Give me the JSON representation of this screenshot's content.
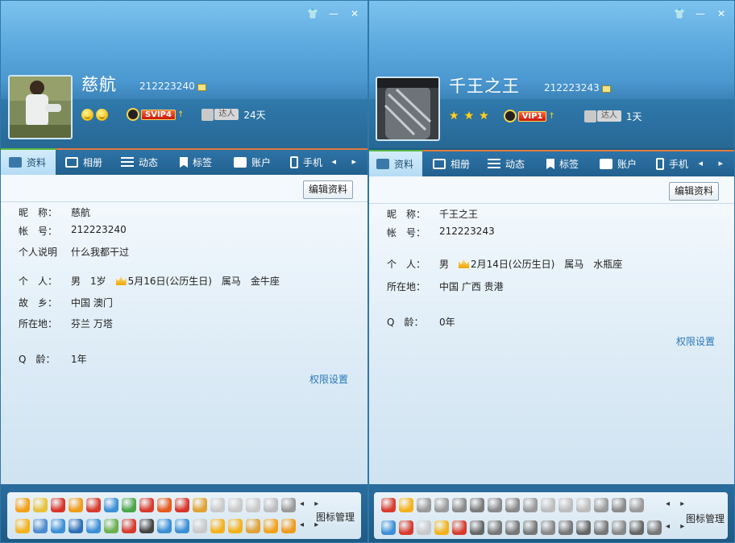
{
  "window_controls": {
    "skin": "👕",
    "minimize": "—",
    "close": "✕"
  },
  "left": {
    "nickname": "慈航",
    "qq_number": "212223240",
    "vip_label": "SVIP4",
    "vip_arrow": "↑",
    "daren_label": "达人",
    "days": "24天",
    "tabs": [
      "资料",
      "相册",
      "动态",
      "标签",
      "账户",
      "手机"
    ],
    "tab_arrows": "◂ ▸",
    "edit_button": "编辑资料",
    "fields": [
      {
        "label": "昵　称：",
        "value": "慈航"
      },
      {
        "label": "帐　号：",
        "value": "212223240"
      },
      {
        "label": "个人说明",
        "value": "什么我都干过"
      },
      {
        "label": "个　人：",
        "value": "男　1岁　",
        "birthday": "5月16日(公历生日)",
        "extra": "　属马　金牛座"
      },
      {
        "label": "故　乡：",
        "value": "中国 澳门"
      },
      {
        "label": "所在地：",
        "value": "芬兰 万塔"
      },
      {
        "label": "Q　龄：",
        "value": "1年"
      }
    ],
    "perm_link": "权限设置",
    "icon_manager": "图标管理",
    "tray_arrows": "◂ ▸",
    "icon_colors_row1": [
      "#f4a11a",
      "#e8c23a",
      "#d9342a",
      "#f19b1a",
      "#d83a2c",
      "#3c8fd6",
      "#4aa64a",
      "#d83a2c",
      "#e45b1e",
      "#d9342a",
      "#e0a233",
      "#c9c9c9",
      "#c9c9c9",
      "#c9c9c9",
      "#bdbdbd",
      "#9a9a9a"
    ],
    "icon_colors_row2": [
      "#f4b21a",
      "#4b8ad0",
      "#3c8fd6",
      "#2f6fb8",
      "#3c8fd6",
      "#6ab04c",
      "#d83a2c",
      "#444444",
      "#3c8fd6",
      "#3c8fd6",
      "#c9c9c9",
      "#f4b21a",
      "#f4b21a",
      "#e0a233",
      "#f4a11a",
      "#f19b1a"
    ]
  },
  "right": {
    "nickname": "千王之王",
    "qq_number": "212223243",
    "vip_label": "VIP1",
    "vip_arrow": "↑",
    "stars": [
      "★",
      "★",
      "★"
    ],
    "daren_label": "达人",
    "days": "1天",
    "tabs": [
      "资料",
      "相册",
      "动态",
      "标签",
      "账户",
      "手机"
    ],
    "tab_arrows": "◂ ▸",
    "edit_button": "编辑资料",
    "fields": [
      {
        "label": "昵　称：",
        "value": "千王之王"
      },
      {
        "label": "帐　号：",
        "value": "212223243"
      },
      {
        "label": "个　人：",
        "value": "男　",
        "birthday": "2月14日(公历生日)",
        "extra": "　属马　水瓶座"
      },
      {
        "label": "所在地：",
        "value": "中国 广西 贵港"
      },
      {
        "label": "Q　龄：",
        "value": "0年"
      }
    ],
    "perm_link": "权限设置",
    "icon_manager": "图标管理",
    "tray_arrows": "◂ ▸",
    "icon_colors_row1": [
      "#d83a2c",
      "#f4b21a",
      "#9a9a9a",
      "#9a9a9a",
      "#8a8a8a",
      "#7a7a7a",
      "#8a8a8a",
      "#8a8a8a",
      "#9a9a9a",
      "#bdbdbd",
      "#bdbdbd",
      "#bdbdbd",
      "#9a9a9a",
      "#8a8a8a",
      "#9a9a9a"
    ],
    "icon_colors_row2": [
      "#3c8fd6",
      "#d83a2c",
      "#c9c9c9",
      "#f4b21a",
      "#d83a2c",
      "#666666",
      "#777777",
      "#777777",
      "#777777",
      "#888888",
      "#777777",
      "#666666",
      "#777777",
      "#888888",
      "#666666",
      "#777777"
    ]
  }
}
